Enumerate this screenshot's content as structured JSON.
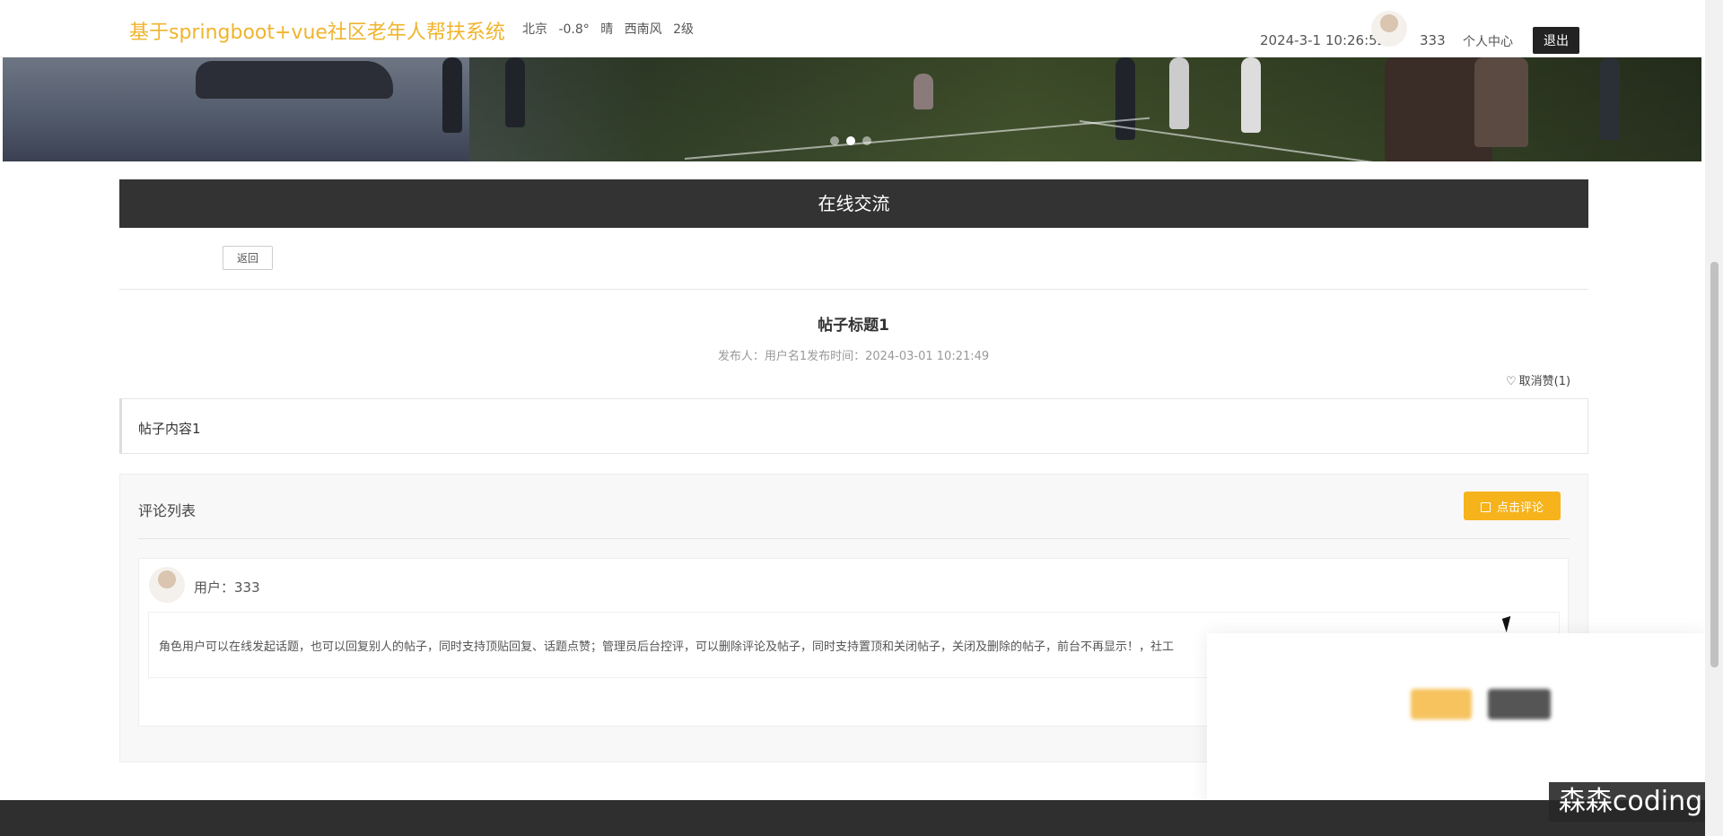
{
  "header": {
    "site_title": "基于springboot+vue社区老年人帮扶系统",
    "weather": {
      "city": "北京",
      "temp": "-0.8°",
      "condition": "晴",
      "wind": "西南风",
      "wind_level": "2级"
    },
    "datetime": "2024-3-1 10:26:52",
    "username": "333",
    "user_center": "个人中心",
    "logout": "退出"
  },
  "banner": {
    "slides": 3,
    "active_slide": 2
  },
  "section": {
    "title": "在线交流"
  },
  "toolbar": {
    "back_label": "返回"
  },
  "post": {
    "title": "帖子标题1",
    "meta": "发布人：用户名1发布时间：2024-03-01 10:21:49",
    "like_label": "取消赞(1)",
    "content": "帖子内容1"
  },
  "comments": {
    "title": "评论列表",
    "add_label": "点击评论",
    "items": [
      {
        "user": "用户：333",
        "text": "角色用户可以在线发起话题，也可以回复别人的帖子，同时支持顶贴回复、话题点赞；管理员后台控评，可以删除评论及帖子，同时支持置顶和关闭帖子，关闭及删除的帖子，前台不再显示！，社工"
      }
    ]
  },
  "watermark": "森森coding",
  "colors": {
    "accent": "#f6b31c",
    "title": "#f0b42d",
    "dark": "#333333"
  }
}
